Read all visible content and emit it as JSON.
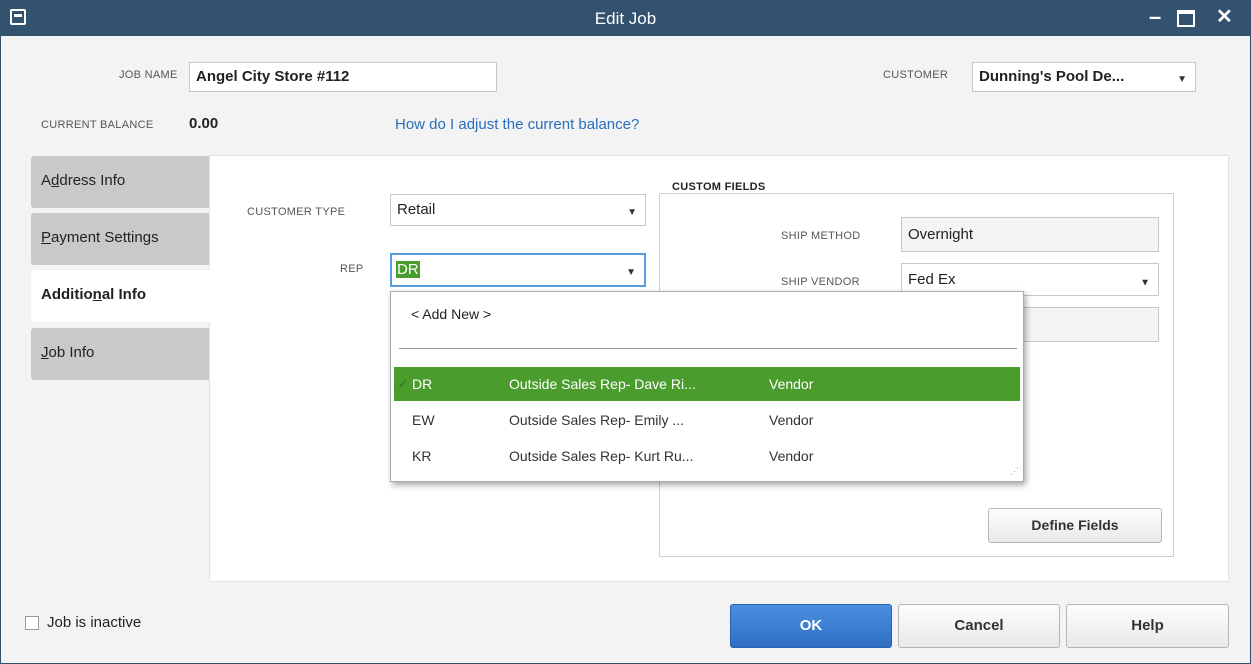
{
  "window": {
    "title": "Edit Job"
  },
  "job_name": {
    "label": "JOB NAME",
    "value": "Angel City Store #112"
  },
  "customer": {
    "label": "CUSTOMER",
    "value": "Dunning's Pool De..."
  },
  "balance": {
    "label": "CURRENT BALANCE",
    "value": "0.00",
    "adjust_link": "How do I adjust the current balance?"
  },
  "tabs": [
    {
      "label_pre": "A",
      "label_u": "d",
      "label_post": "dress Info"
    },
    {
      "label_pre": "",
      "label_u": "P",
      "label_post": "ayment Settings"
    },
    {
      "label_pre": "Additio",
      "label_u": "n",
      "label_post": "al Info"
    },
    {
      "label_pre": "",
      "label_u": "J",
      "label_post": "ob Info"
    }
  ],
  "additional": {
    "customer_type_label": "CUSTOMER TYPE",
    "customer_type_value": "Retail",
    "rep_label": "REP",
    "rep_value": "DR"
  },
  "custom_fields": {
    "legend": "CUSTOM FIELDS",
    "ship_method_label": "SHIP METHOD",
    "ship_method_value": "Overnight",
    "ship_vendor_label": "SHIP VENDOR",
    "ship_vendor_value": "Fed Ex",
    "define_button": "Define Fields"
  },
  "rep_dropdown": {
    "add_new": "< Add New >",
    "rows": [
      {
        "initials": "DR",
        "name": "Outside Sales Rep- Dave Ri...",
        "type": "Vendor",
        "check": "✓"
      },
      {
        "initials": "EW",
        "name": "Outside Sales Rep- Emily ...",
        "type": "Vendor"
      },
      {
        "initials": "KR",
        "name": "Outside Sales Rep- Kurt Ru...",
        "type": "Vendor"
      }
    ]
  },
  "footer": {
    "inactive_label": "Job is inactive",
    "ok": "OK",
    "cancel": "Cancel",
    "help": "Help"
  },
  "colors": {
    "titlebar": "#33526f",
    "selection": "#4a9d2c",
    "ok_button": "#2f6fc3",
    "link": "#2a6ebd"
  }
}
